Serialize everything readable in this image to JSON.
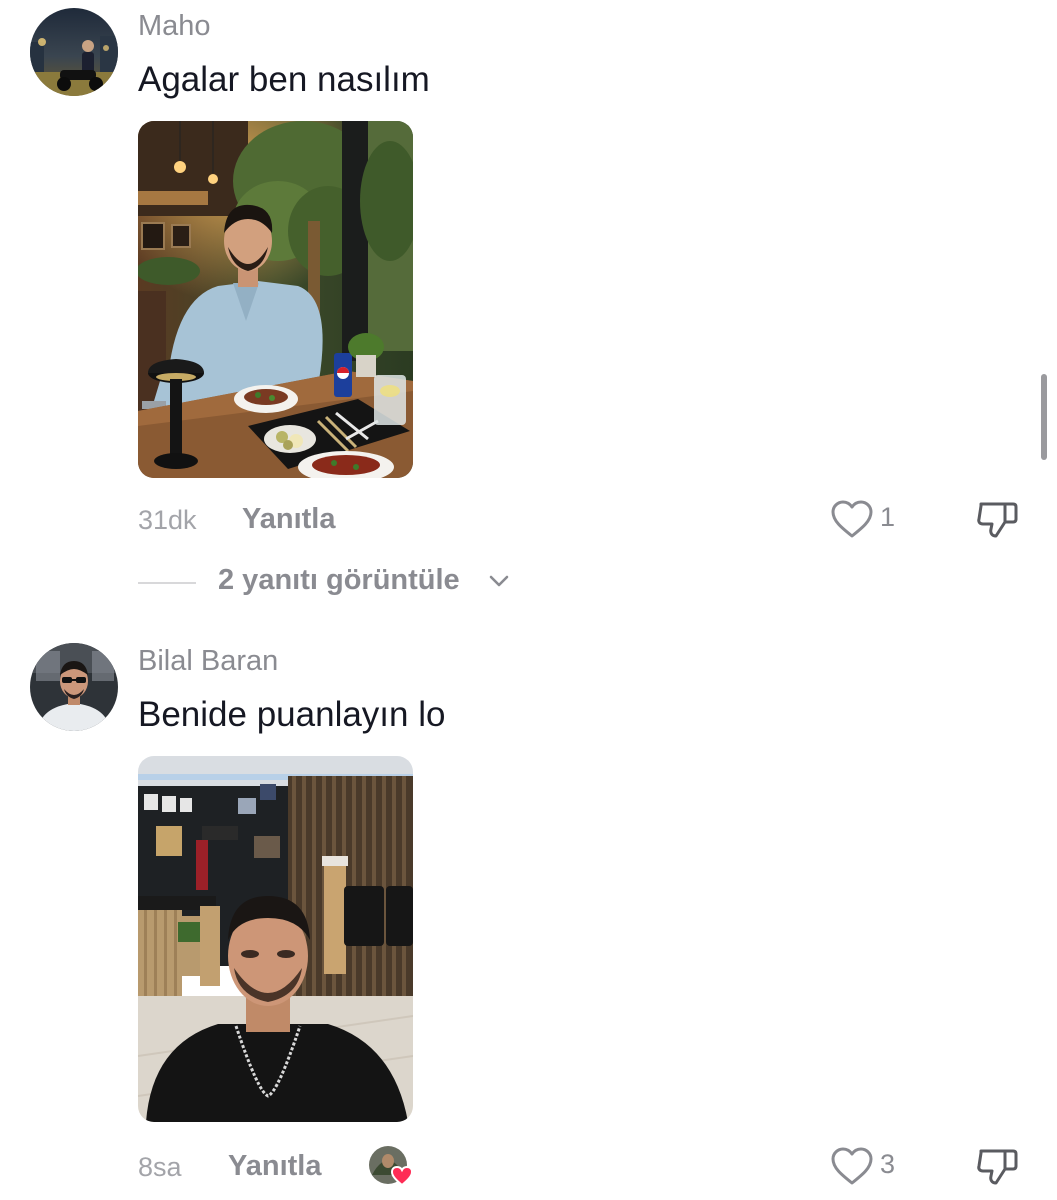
{
  "comments": [
    {
      "username": "Maho",
      "text": "Agalar ben nasılım",
      "timestamp": "31dk",
      "reply_label": "Yanıtla",
      "like_count": "1",
      "view_replies_label": "2 yanıtı görüntüle"
    },
    {
      "username": "Bilal Baran",
      "text": "Benide puanlayın lo",
      "timestamp": "8sa",
      "reply_label": "Yanıtla",
      "like_count": "3"
    }
  ],
  "icons": {
    "like": "heart-outline-icon",
    "dislike": "thumbs-down-icon",
    "expand": "chevron-down-icon",
    "creator_liked": "red-heart-badge-icon"
  },
  "colors": {
    "text_primary": "#161823",
    "text_secondary": "#8a8b91",
    "creator_heart": "#fe2c55"
  }
}
